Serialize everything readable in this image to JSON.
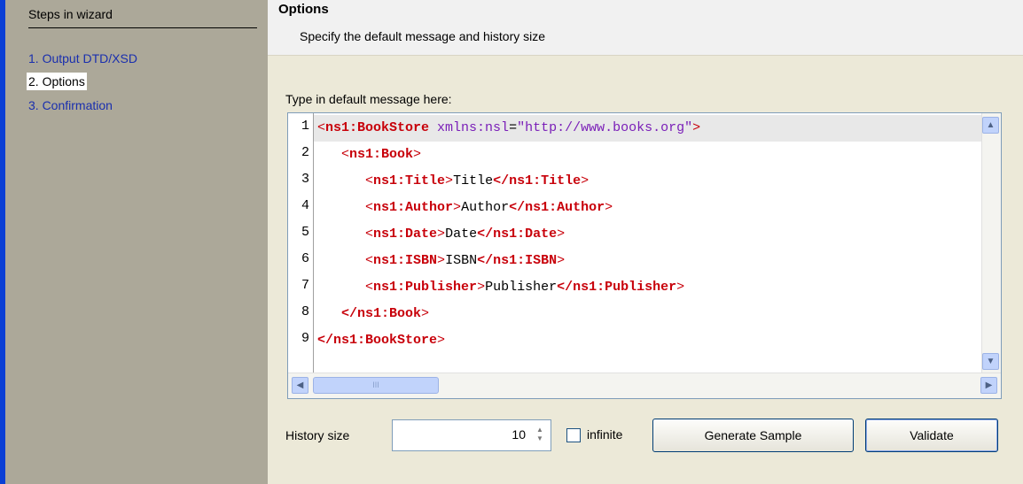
{
  "sidebar": {
    "title": "Steps in wizard",
    "steps": [
      {
        "label": "1. Output DTD/XSD"
      },
      {
        "label": "2. Options"
      },
      {
        "label": "3. Confirmation"
      }
    ]
  },
  "header": {
    "title": "Options",
    "subtitle": "Specify the default message and history size"
  },
  "editor": {
    "label": "Type in default message here:",
    "line_numbers": [
      "1",
      "2",
      "3",
      "4",
      "5",
      "6",
      "7",
      "8",
      "9"
    ],
    "lines": [
      {
        "indent": "",
        "open": "<ns1:BookStore",
        "attr": " xmlns:nsl",
        "eq": "=",
        "val": "\"http://www.books.org\"",
        "close": ">"
      },
      {
        "indent": "   ",
        "open": "<ns1:Book",
        "close": ">"
      },
      {
        "indent": "      ",
        "open": "<ns1:Title",
        "close": ">",
        "text": "Title",
        "end": "</ns1:Title",
        "end_close": ">"
      },
      {
        "indent": "      ",
        "open": "<ns1:Author",
        "close": ">",
        "text": "Author",
        "end": "</ns1:Author",
        "end_close": ">"
      },
      {
        "indent": "      ",
        "open": "<ns1:Date",
        "close": ">",
        "text": "Date",
        "end": "</ns1:Date",
        "end_close": ">"
      },
      {
        "indent": "      ",
        "open": "<ns1:ISBN",
        "close": ">",
        "text": "ISBN",
        "end": "</ns1:ISBN",
        "end_close": ">"
      },
      {
        "indent": "      ",
        "open": "<ns1:Publisher",
        "close": ">",
        "text": "Publisher",
        "end": "</ns1:Publisher",
        "end_close": ">"
      },
      {
        "indent": "   ",
        "end": "</ns1:Book",
        "end_close": ">"
      },
      {
        "indent": "",
        "end": "</ns1:BookStore",
        "end_close": ">"
      }
    ],
    "scroll_thumb_glyph": "III"
  },
  "footer": {
    "history_label": "History size",
    "history_value": "10",
    "infinite_label": "infinite",
    "generate_label": "Generate Sample",
    "validate_label": "Validate"
  },
  "colors": {
    "tag": "#c8000a",
    "attribute": "#7a1fb8",
    "sidebar_bg": "#aca899",
    "accent_strip": "#0a3fd6"
  }
}
